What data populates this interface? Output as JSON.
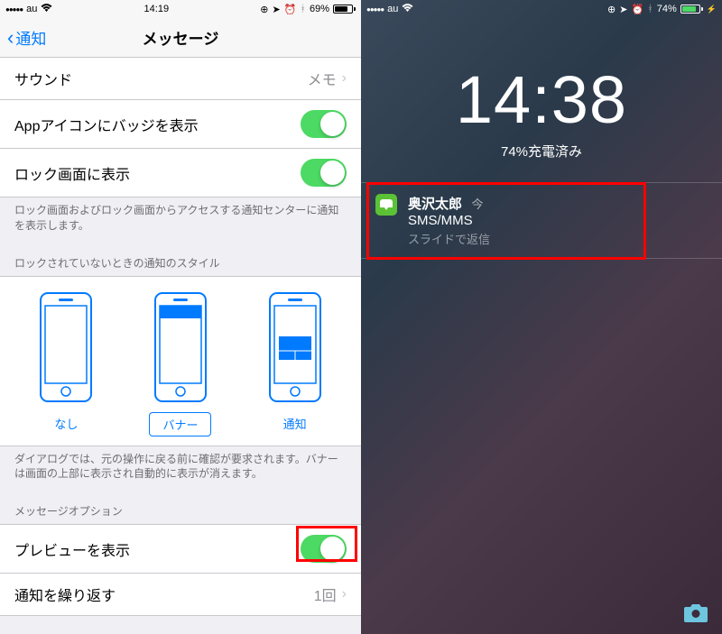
{
  "left": {
    "status": {
      "carrier": "au",
      "time": "14:19",
      "battery_pct": "69%",
      "battery_fill_width": "69%",
      "battery_color": "#000"
    },
    "nav": {
      "back": "通知",
      "title": "メッセージ"
    },
    "cells": {
      "sound": {
        "label": "サウンド",
        "value": "メモ"
      },
      "badge": {
        "label": "Appアイコンにバッジを表示"
      },
      "lockscreen": {
        "label": "ロック画面に表示"
      },
      "preview": {
        "label": "プレビューを表示"
      },
      "repeat": {
        "label": "通知を繰り返す",
        "value": "1回"
      }
    },
    "footers": {
      "lock_desc": "ロック画面およびロック画面からアクセスする通知センターに通知を表示します。",
      "style_desc": "ダイアログでは、元の操作に戻る前に確認が要求されます。バナーは画面の上部に表示され自動的に表示が消えます。"
    },
    "headers": {
      "style": "ロックされていないときの通知のスタイル",
      "msg_opts": "メッセージオプション"
    },
    "styles": {
      "none": "なし",
      "banner": "バナー",
      "alert": "通知"
    }
  },
  "right": {
    "status": {
      "carrier": "au",
      "battery_pct": "74%",
      "battery_fill_width": "74%",
      "battery_color": "#4cd964"
    },
    "time": "14:38",
    "charging": "74%充電済み",
    "notif": {
      "sender": "奥沢太郎",
      "when": "今",
      "sub": "SMS/MMS",
      "hint": "スライドで返信"
    }
  }
}
